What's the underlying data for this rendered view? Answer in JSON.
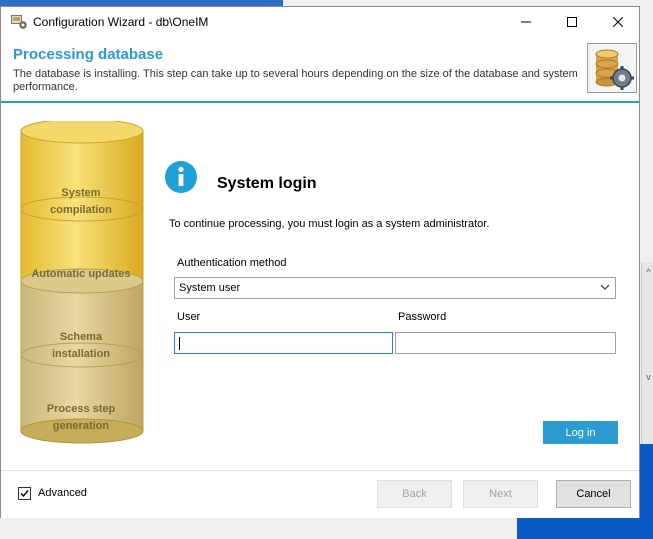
{
  "window": {
    "title": "Configuration Wizard - db\\OneIM",
    "controls": [
      "minimize",
      "maximize",
      "close"
    ]
  },
  "header": {
    "title": "Processing database",
    "description": "The database is installing. This step can take up to several hours depending on the size of the database and system performance.",
    "icon": "database-gear-icon"
  },
  "steps": [
    {
      "label_line1": "System",
      "label_line2": "compilation"
    },
    {
      "label_line1": "Automatic updates",
      "label_line2": ""
    },
    {
      "label_line1": "Schema",
      "label_line2": "installation"
    },
    {
      "label_line1": "Process step",
      "label_line2": "generation"
    }
  ],
  "login": {
    "title": "System login",
    "message": "To continue processing, you must login as a system administrator.",
    "auth_label": "Authentication method",
    "auth_value": "System user",
    "user_label": "User",
    "user_value": "",
    "password_label": "Password",
    "password_value": "",
    "login_button": "Log in"
  },
  "footer": {
    "advanced_label": "Advanced",
    "advanced_checked": true,
    "back": "Back",
    "next": "Next",
    "cancel": "Cancel"
  },
  "colors": {
    "accent": "#2b9bd1",
    "cylinder": "#e9c84a",
    "cylinder_shadow": "#b9a57a"
  }
}
